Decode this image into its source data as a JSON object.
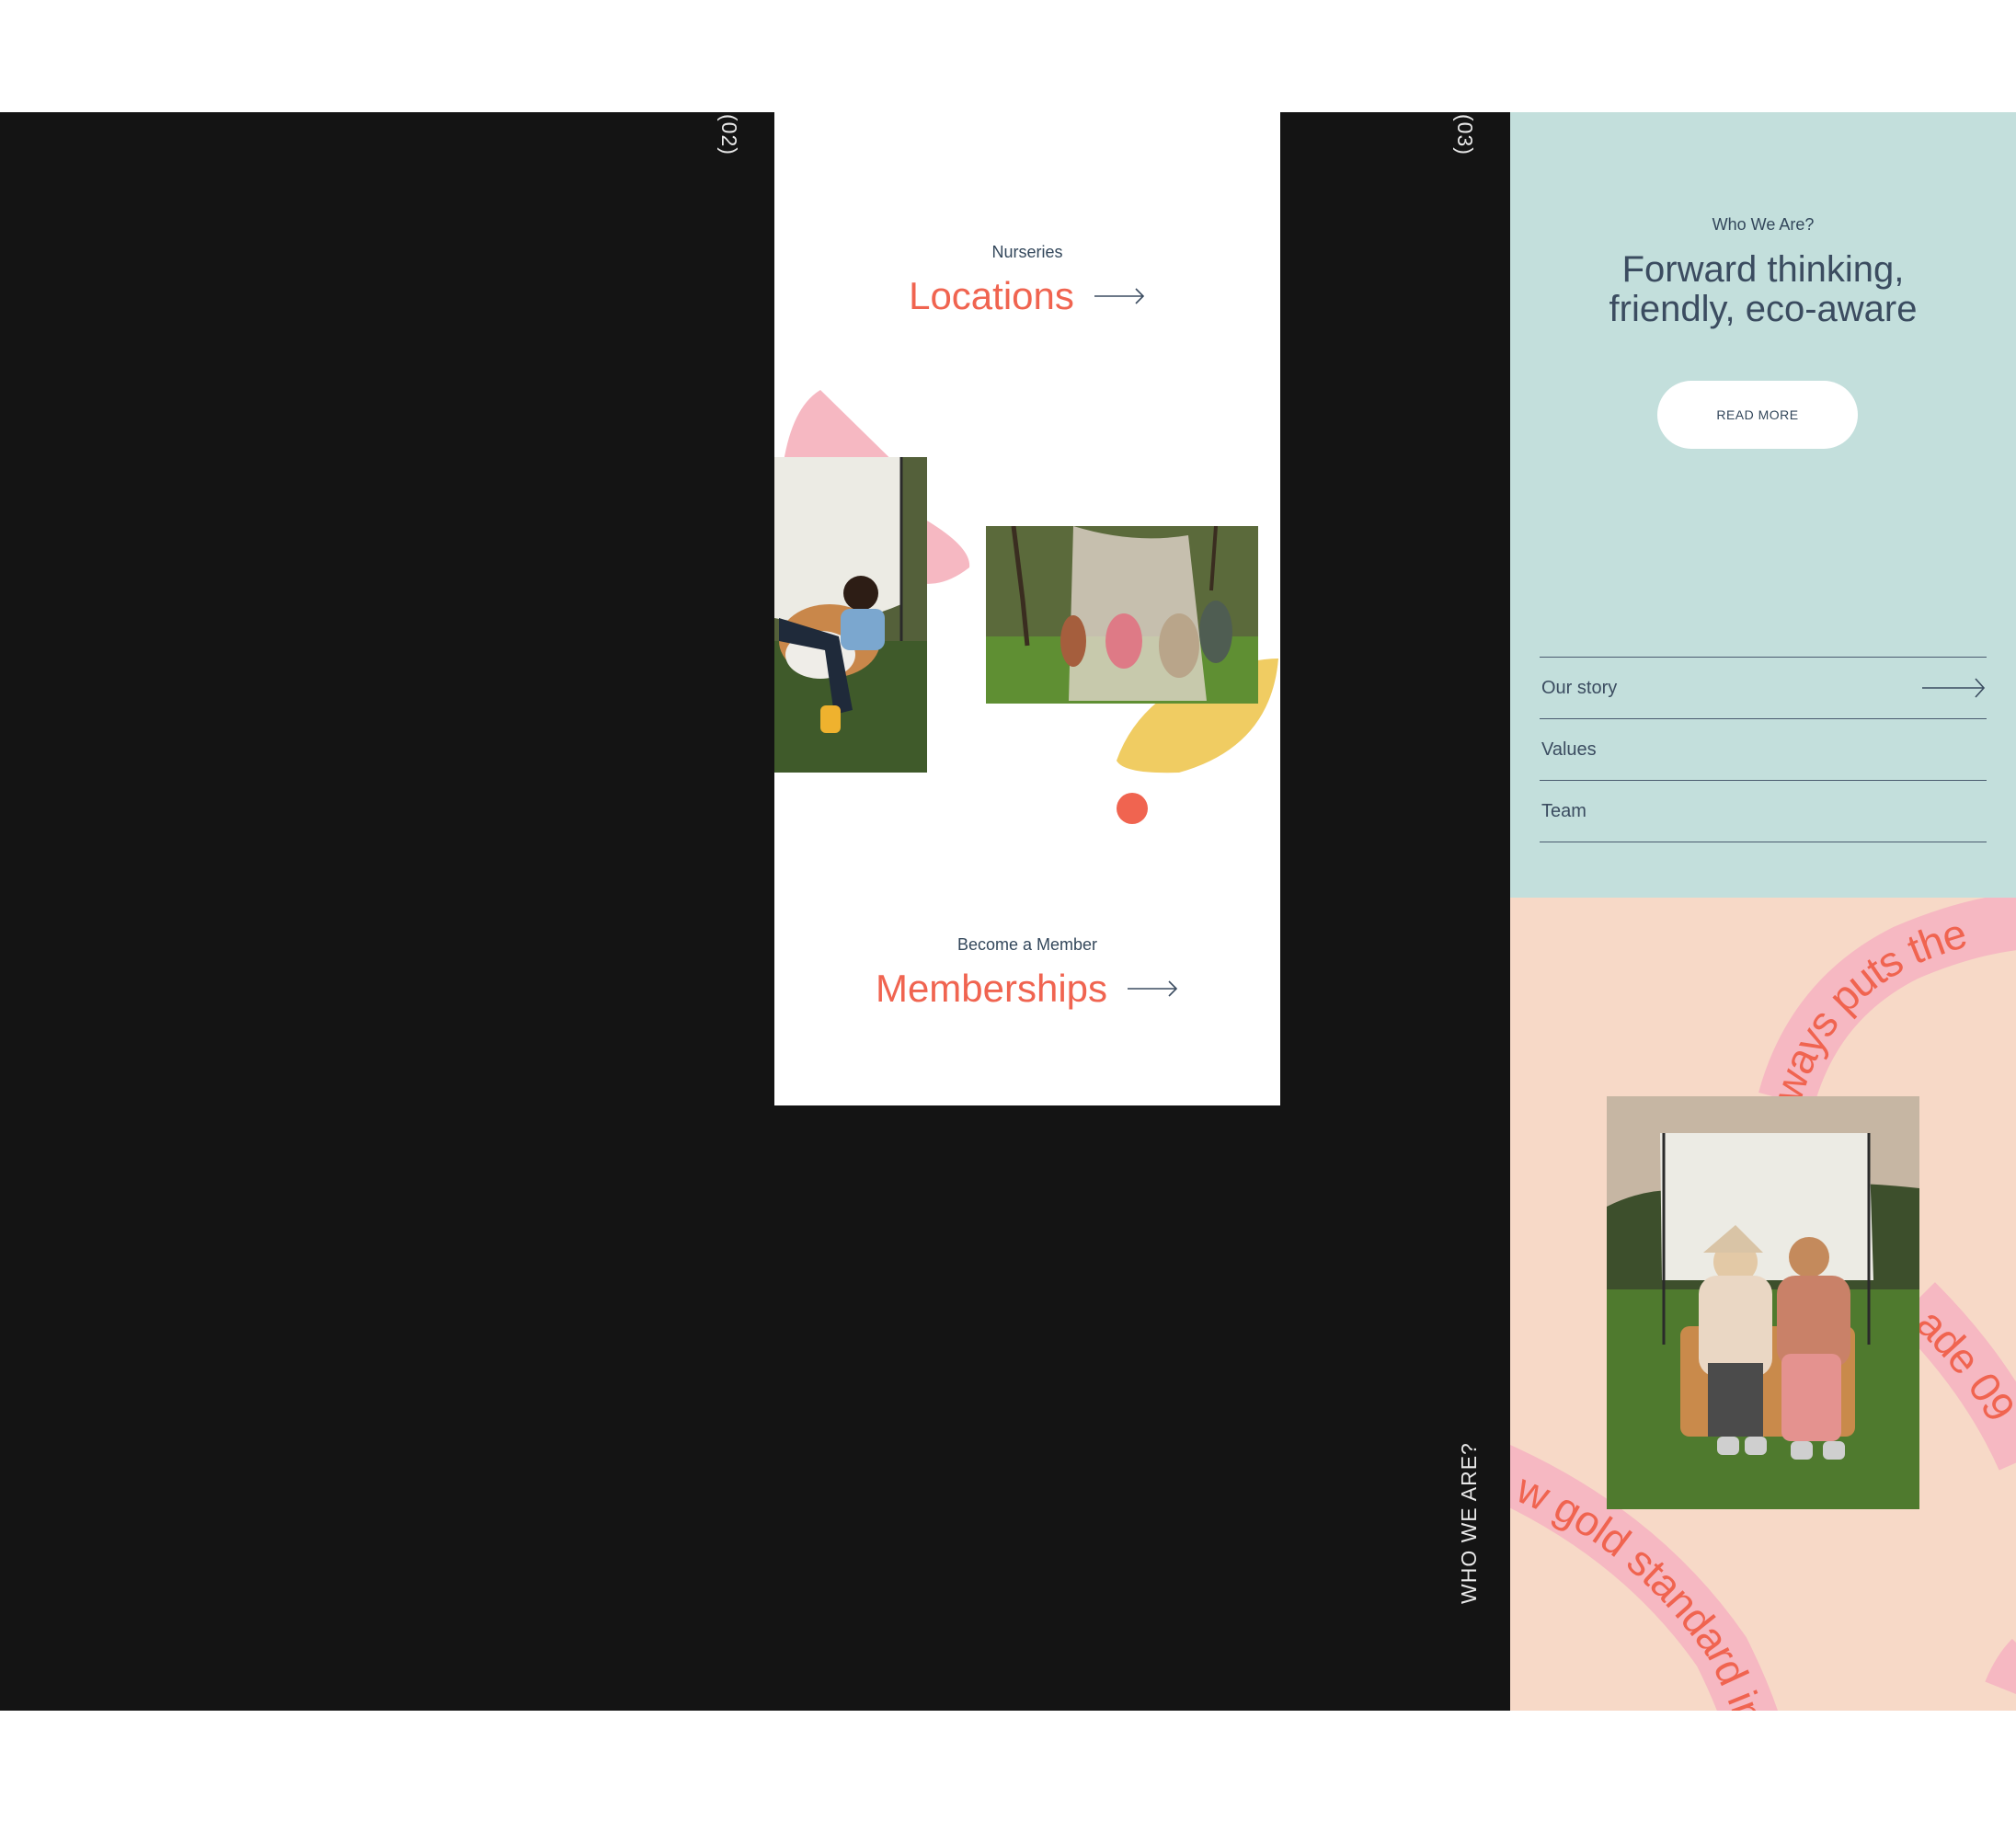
{
  "section_numbers": {
    "left": "(02)",
    "right": "(03)"
  },
  "vertical_label": "WHO WE ARE?",
  "nurseries": {
    "eyebrow": "Nurseries",
    "link_label": "Locations"
  },
  "membership": {
    "eyebrow": "Become a Member",
    "link_label": "Memberships"
  },
  "who_we_are": {
    "eyebrow": "Who We Are?",
    "title_line1": "Forward thinking,",
    "title_line2": "friendly, eco-aware",
    "button_label": "READ MORE",
    "menu": [
      {
        "label": "Our story"
      },
      {
        "label": "Values"
      },
      {
        "label": "Team"
      }
    ]
  },
  "ribbon_text": {
    "top": "ways puts the",
    "right": "ade 09",
    "bottom": "w gold standard in"
  },
  "colors": {
    "coral": "#f06450",
    "pink": "#f6b8c2",
    "yellow": "#f0cc62",
    "mint": "#c3dfdc",
    "peach": "#f7d9c7",
    "dark": "#141414",
    "navy_text": "#33475b"
  },
  "icons": [
    "arrow-right-icon"
  ]
}
